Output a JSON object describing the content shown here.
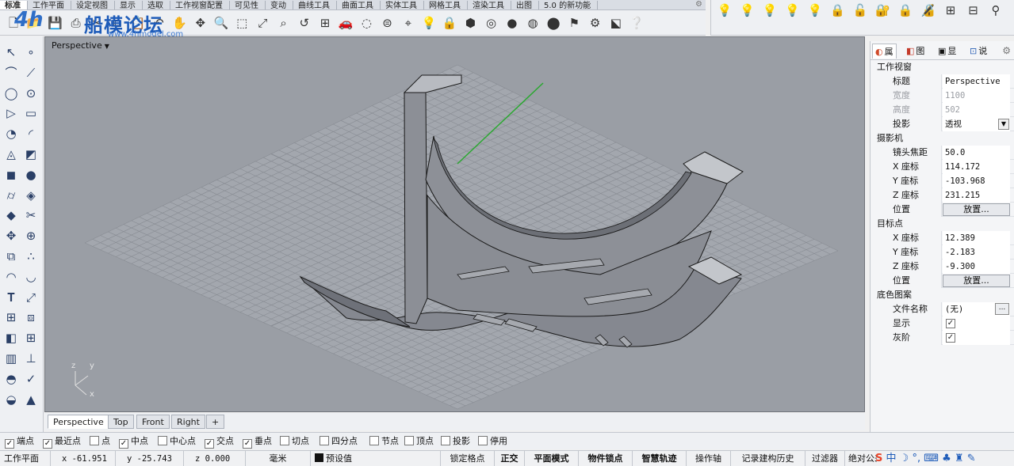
{
  "tabbar": {
    "tabs": [
      "标准",
      "工作平面",
      "设定视图",
      "显示",
      "选取",
      "工作视窗配置",
      "可见性",
      "变动",
      "曲线工具",
      "曲面工具",
      "实体工具",
      "网格工具",
      "渲染工具",
      "出图",
      "5.0 的新功能"
    ],
    "active": "标准"
  },
  "watermark": {
    "mark": "4h",
    "title": "船模论坛",
    "url": "www.4hmodel.com"
  },
  "toolbar_icons": [
    "new-file-icon",
    "open-folder-icon",
    "save-icon",
    "print-icon",
    "cut-icon",
    "copy-icon",
    "paste-icon",
    "undo-icon",
    "pan-hand-icon",
    "rotate-view-icon",
    "zoom-icon",
    "zoom-window-icon",
    "zoom-extents-icon",
    "zoom-selected-icon",
    "undo-view-icon",
    "four-viewports-icon",
    "car-icon",
    "hide-icon",
    "layer-icon",
    "tag-icon",
    "lightbulb-icon",
    "lock-icon",
    "material-icon",
    "color-wheel-icon",
    "sphere-shaded-icon",
    "sphere-rendered-icon",
    "sphere-blue-icon",
    "filter-icon",
    "gear-options-icon",
    "explode-icon",
    "help-icon"
  ],
  "toolbar2_icons": [
    "light-on-icon",
    "light-off-icon",
    "light-dim-icon",
    "light-group-icon",
    "light-pair-icon",
    "lock-icon",
    "unlock-icon",
    "lock-swap-icon",
    "lock-group-icon",
    "lock-pair-icon",
    "grid-select-icon",
    "grid-deselect-icon",
    "filter-select-icon"
  ],
  "palette_icons": [
    "select-arrow-icon",
    "point-icon",
    "polyline-icon",
    "curve-point-icon",
    "circle-icon",
    "ellipse-icon",
    "polygon-icon",
    "rectangle-icon",
    "circle-arc-icon",
    "arc-icon",
    "surface-point-icon",
    "extrude-icon",
    "box-icon",
    "sphere-icon",
    "cylinder-icon",
    "mesh-icon",
    "explode-icon",
    "trim-icon",
    "move-icon",
    "join-icon",
    "boolean-icon",
    "dots-icon",
    "fillet-icon",
    "rebuild-icon",
    "text-icon",
    "scale-icon",
    "array-icon",
    "mirror-icon",
    "solid-icon",
    "grid-icon",
    "dim-grid-icon",
    "dimension-icon",
    "curve-surface-icon",
    "checkmark-icon",
    "layer-shade-icon",
    "light-icon"
  ],
  "viewport": {
    "title": "Perspective",
    "axis_y": "y",
    "axis_z": "z",
    "axis_x": "x",
    "colors": {
      "background": "#9a9ea5",
      "grid": "#888c93",
      "model": "#7d8088",
      "edge": "#1a1a1a",
      "green_axis": "#2aa830"
    }
  },
  "viewport_tabs": [
    "Perspective",
    "Top",
    "Front",
    "Right"
  ],
  "viewport_tab_add": "+",
  "panel": {
    "tabs": [
      {
        "label": "属",
        "icon": "properties-icon"
      },
      {
        "label": "图",
        "icon": "layers-icon"
      },
      {
        "label": "显",
        "icon": "display-icon"
      },
      {
        "label": "说",
        "icon": "help-icon"
      }
    ],
    "sections": {
      "viewport": "工作视窗",
      "camera": "摄影机",
      "target": "目标点",
      "wallpaper": "底色图案"
    },
    "rows": {
      "title_lbl": "标题",
      "title_val": "Perspective",
      "width_lbl": "宽度",
      "width_val": "1100",
      "height_lbl": "高度",
      "height_val": "502",
      "proj_lbl": "投影",
      "proj_val": "透视",
      "lens_lbl": "镜头焦距",
      "lens_val": "50.0",
      "cx_lbl": "X 座标",
      "cx_val": "114.172",
      "cy_lbl": "Y 座标",
      "cy_val": "-103.968",
      "cz_lbl": "Z 座标",
      "cz_val": "231.215",
      "cpos_lbl": "位置",
      "cpos_btn": "放置...",
      "tx_lbl": "X 座标",
      "tx_val": "12.389",
      "ty_lbl": "Y 座标",
      "ty_val": "-2.183",
      "tz_lbl": "Z 座标",
      "tz_val": "-9.300",
      "tpos_lbl": "位置",
      "tpos_btn": "放置...",
      "file_lbl": "文件名称",
      "file_val": "(无)",
      "file_btn": "...",
      "show_lbl": "显示",
      "show_val": "✓",
      "gray_lbl": "灰阶",
      "gray_val": "✓"
    }
  },
  "osnap": [
    {
      "label": "端点",
      "checked": "✓"
    },
    {
      "label": "最近点",
      "checked": "✓"
    },
    {
      "label": "点",
      "checked": ""
    },
    {
      "label": "中点",
      "checked": "✓"
    },
    {
      "label": "中心点",
      "checked": ""
    },
    {
      "label": "交点",
      "checked": "✓"
    },
    {
      "label": "垂点",
      "checked": "✓"
    },
    {
      "label": "切点",
      "checked": ""
    },
    {
      "label": "四分点",
      "checked": ""
    },
    {
      "label": "节点",
      "checked": ""
    },
    {
      "label": "顶点",
      "checked": ""
    },
    {
      "label": "投影",
      "checked": ""
    },
    {
      "label": "停用",
      "checked": ""
    }
  ],
  "status": {
    "plane": "工作平面",
    "x": "x -61.951",
    "y": "y -25.743",
    "z": "z 0.000",
    "units": "毫米",
    "layer": "预设值",
    "grid_snap": "锁定格点",
    "ortho": "正交",
    "planar": "平面模式",
    "osnap": "物件锁点",
    "smart_track": "智慧轨迹",
    "gumball": "操作轴",
    "history": "记录建构历史",
    "filter": "过滤器",
    "tolerance": "绝对公差",
    "ime": "中"
  }
}
